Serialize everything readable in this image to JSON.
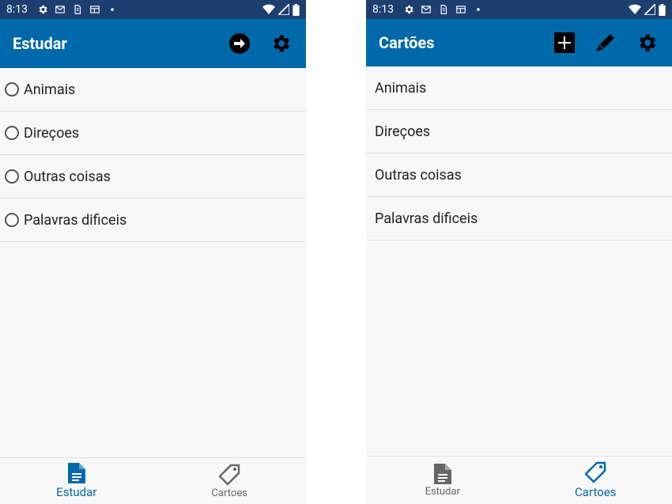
{
  "colors": {
    "status_bar": "#1c3f70",
    "app_bar": "#0069aa",
    "active_nav": "#0069aa",
    "inactive_nav": "#666666"
  },
  "left": {
    "status": {
      "time": "8:13"
    },
    "title": "Estudar",
    "actions": [
      "arrow-circle-right-icon",
      "gear-icon"
    ],
    "items": [
      {
        "label": "Animais"
      },
      {
        "label": "Direçoes"
      },
      {
        "label": "Outras coisas"
      },
      {
        "label": "Palavras dificeis"
      }
    ],
    "nav": [
      {
        "label": "Estudar",
        "icon": "document-icon",
        "active": true
      },
      {
        "label": "Cartoes",
        "icon": "tag-icon",
        "active": false
      }
    ]
  },
  "right": {
    "status": {
      "time": "8:13"
    },
    "title": "Cartões",
    "actions": [
      "add-box-icon",
      "pencil-icon",
      "gear-icon"
    ],
    "items": [
      {
        "label": "Animais"
      },
      {
        "label": "Direçoes"
      },
      {
        "label": "Outras coisas"
      },
      {
        "label": "Palavras dificeis"
      }
    ],
    "nav": [
      {
        "label": "Estudar",
        "icon": "document-icon",
        "active": false
      },
      {
        "label": "Cartoes",
        "icon": "tag-icon",
        "active": true
      }
    ]
  }
}
